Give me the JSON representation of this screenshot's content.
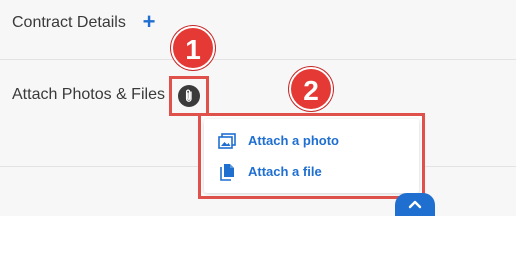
{
  "rows": {
    "contract_details_label": "Contract Details",
    "add_symbol": "+",
    "attach_label": "Attach Photos & Files"
  },
  "annotations": {
    "badge_1": "1",
    "badge_2": "2",
    "highlight_color": "#e0514b",
    "badge_color": "#e53935"
  },
  "attach_menu": {
    "items": [
      {
        "label": "Attach a photo",
        "icon": "photo-icon"
      },
      {
        "label": "Attach a file",
        "icon": "file-icon"
      }
    ]
  },
  "colors": {
    "accent": "#1f6fd1",
    "text": "#3a3a3a",
    "panel_bg": "#f7f7f7"
  },
  "icons": {
    "attach_button": "paperclip-icon",
    "scroll_button": "chevron-up-icon"
  }
}
